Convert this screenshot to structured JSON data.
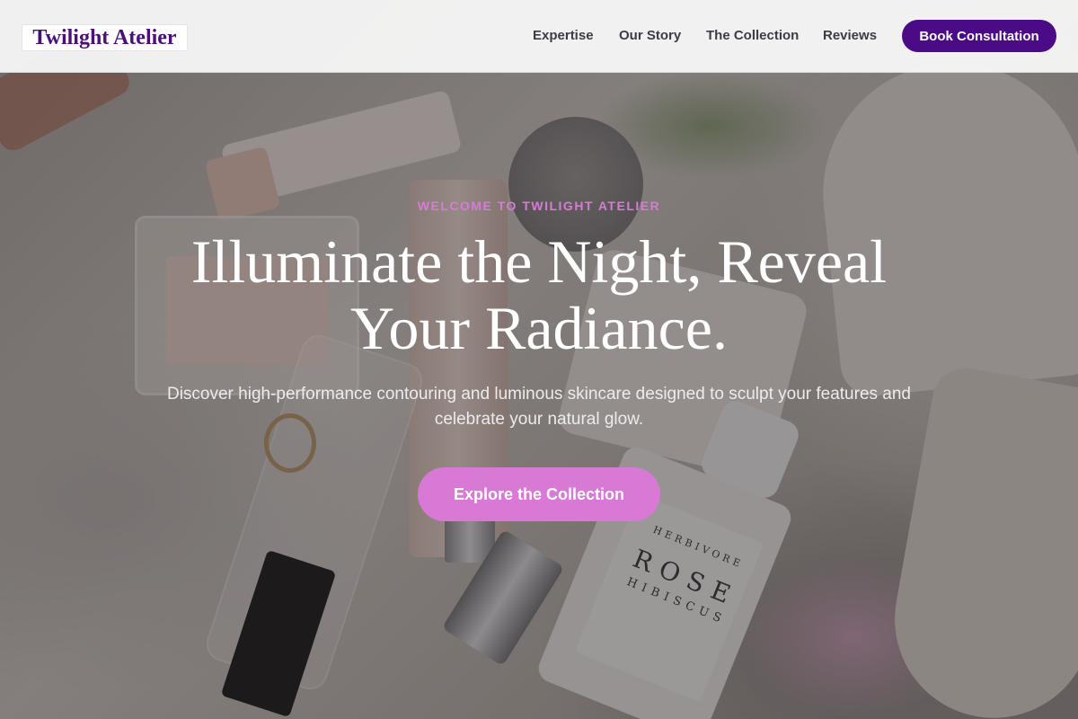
{
  "brand": {
    "logo_text": "Twilight Atelier",
    "accent_color": "#4b0a86",
    "highlight_color": "#d879d6"
  },
  "nav": {
    "items": [
      {
        "label": "Expertise"
      },
      {
        "label": "Our Story"
      },
      {
        "label": "The Collection"
      },
      {
        "label": "Reviews"
      }
    ],
    "cta_label": "Book Consultation"
  },
  "hero": {
    "eyebrow": "WELCOME TO TWILIGHT ATELIER",
    "headline": "Illuminate the Night, Reveal Your Radiance.",
    "subtext": "Discover high-performance contouring and luminous skincare designed to sculpt your features and celebrate your natural glow.",
    "cta_label": "Explore the Collection"
  },
  "background_photo": {
    "spray_brand": "HERBIVORE",
    "spray_name": "ROSE",
    "spray_variant": "HIBISCUS"
  }
}
